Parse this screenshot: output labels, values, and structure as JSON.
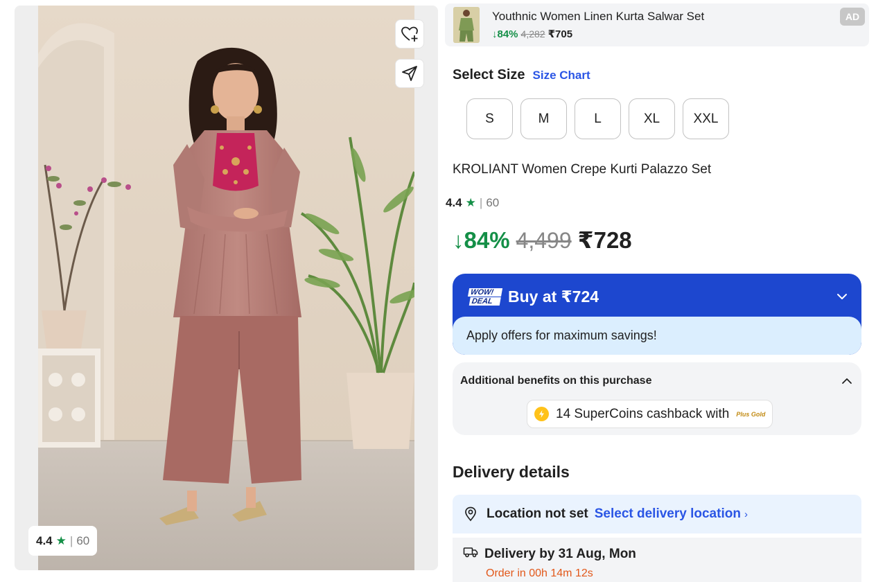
{
  "gallery": {
    "rating_value": "4.4",
    "rating_sep": "|",
    "rating_count": "60",
    "icons": [
      "wishlist-add-icon",
      "share-icon",
      "star-icon"
    ]
  },
  "ad": {
    "title": "Youthnic Women Linen Kurta Salwar Set",
    "discount": "↓84%",
    "mrp": "4,282",
    "price": "₹705",
    "badge": "AD"
  },
  "size": {
    "title": "Select Size",
    "chart_link": "Size Chart",
    "options": [
      "S",
      "M",
      "L",
      "XL",
      "XXL"
    ]
  },
  "product": {
    "title": "KROLIANT Women Crepe Kurti Palazzo Set",
    "rating_value": "4.4",
    "rating_sep": "|",
    "rating_count": "60",
    "discount": "↓84%",
    "mrp": "4,499",
    "price": "₹728"
  },
  "deal": {
    "logo_line1": "WOW!",
    "logo_line2": "DEAL",
    "label": "Buy at ₹724",
    "subtext": "Apply offers for maximum savings!"
  },
  "benefits": {
    "title": "Additional benefits on this purchase",
    "coins_text": "14 SuperCoins cashback with",
    "plus_label": "Plus Gold"
  },
  "delivery": {
    "title": "Delivery details",
    "location_status": "Location not set",
    "location_link": "Select delivery location",
    "date_text": "Delivery by 31 Aug, Mon",
    "order_timer": "Order in 00h 14m 12s"
  },
  "colors": {
    "accent_blue": "#2a55e5",
    "deal_blue": "#1d47cf",
    "discount_green": "#148f47",
    "timer_orange": "#e2581a"
  }
}
